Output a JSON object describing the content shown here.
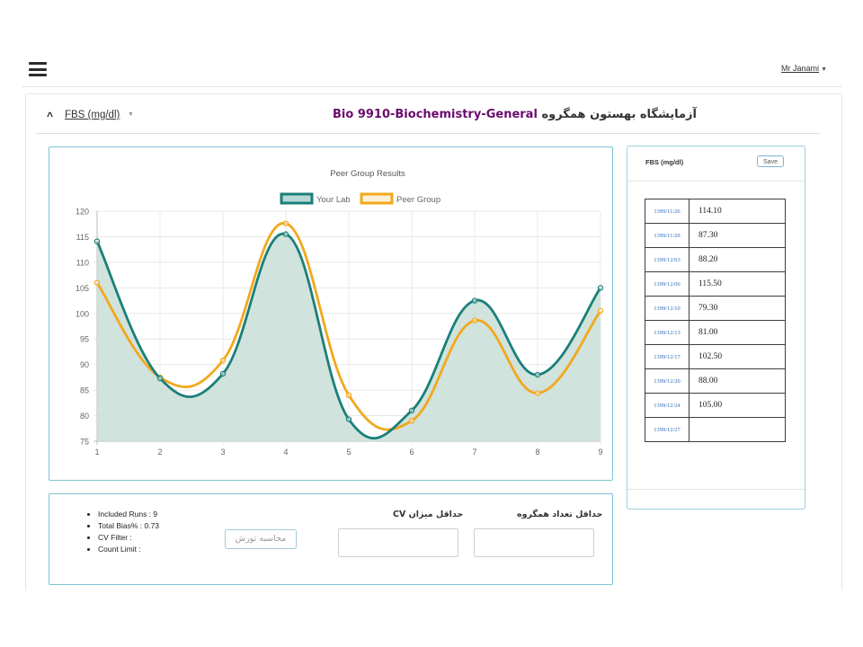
{
  "header": {
    "user_label": "Mr Janami"
  },
  "section": {
    "test_label": "FBS (mg/dl)",
    "lab_prefix": "آزمایشگاه بهستون همگروه",
    "lab_name": "Bio 9910-Biochemistry-General"
  },
  "chart_data": {
    "type": "line",
    "title": "Peer Group Results",
    "x": [
      1,
      2,
      3,
      4,
      5,
      6,
      7,
      8,
      9
    ],
    "series": [
      {
        "name": "Your Lab",
        "values": [
          114.1,
          87.3,
          88.2,
          115.5,
          79.3,
          81.0,
          102.5,
          88.0,
          105.0
        ],
        "color": "#1b7f7a",
        "fill": "#c9ded7"
      },
      {
        "name": "Peer Group",
        "values": [
          106.0,
          87.5,
          90.8,
          117.6,
          84.0,
          79.0,
          98.6,
          84.4,
          100.5
        ],
        "color": "#f2a81d"
      }
    ],
    "ylim": [
      75,
      120
    ],
    "yticks": [
      75,
      80,
      85,
      90,
      95,
      100,
      105,
      110,
      115,
      120
    ],
    "xlim": [
      1,
      9
    ],
    "grid": true,
    "legend": "top-center"
  },
  "side_panel": {
    "title": "FBS (mg/dl)",
    "save_label": "Save",
    "rows": [
      {
        "date": "1399/11/26",
        "value": "114.10"
      },
      {
        "date": "1399/11/29",
        "value": "87.30"
      },
      {
        "date": "1399/12/03",
        "value": "88.20"
      },
      {
        "date": "1399/12/06",
        "value": "115.50"
      },
      {
        "date": "1399/12/10",
        "value": "79.30"
      },
      {
        "date": "1399/12/13",
        "value": "81.00"
      },
      {
        "date": "1399/12/17",
        "value": "102.50"
      },
      {
        "date": "1399/12/20",
        "value": "88.00"
      },
      {
        "date": "1399/12/24",
        "value": "105.00"
      },
      {
        "date": "1399/12/27",
        "value": ""
      }
    ]
  },
  "stats": {
    "included_runs": "Included Runs : 9",
    "total_bias": "Total Bias% : 0.73",
    "cv_filter": "CV Filter :",
    "count_limit": "Count Limit :",
    "calc_button": "محاسبه تورش",
    "cv_label": "حداقل میزان CV",
    "count_label": "حداقل تعداد همگروه",
    "cv_value": "",
    "count_value": ""
  },
  "colors": {
    "accent_border": "#7ec3d4",
    "lab_name": "#6a0b6e",
    "link": "#2e6fb8"
  }
}
